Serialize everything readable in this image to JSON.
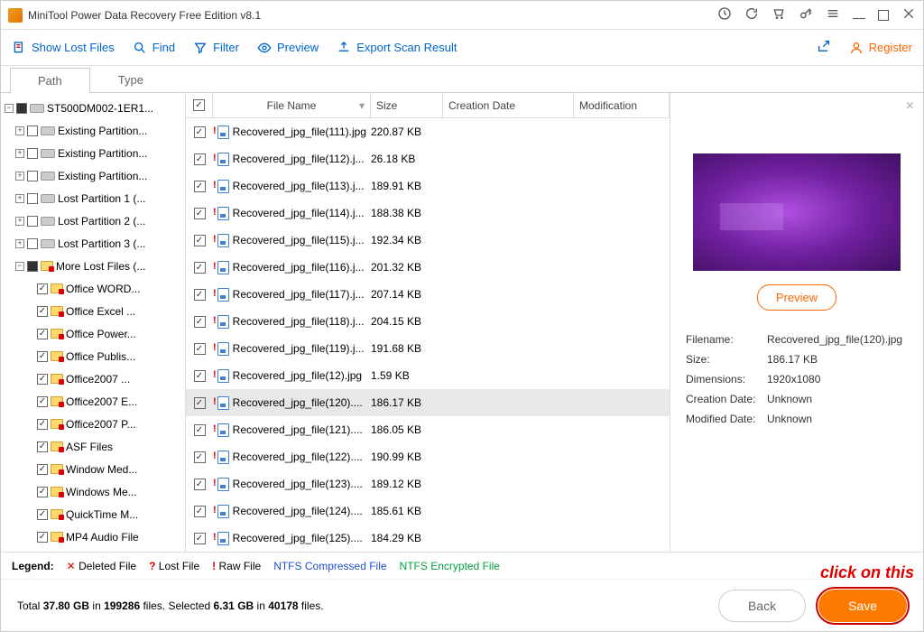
{
  "window": {
    "title": "MiniTool Power Data Recovery Free Edition v8.1"
  },
  "toolbar": {
    "showLost": "Show Lost Files",
    "find": "Find",
    "filter": "Filter",
    "preview": "Preview",
    "export": "Export Scan Result",
    "register": "Register"
  },
  "tabs": {
    "path": "Path",
    "type": "Type"
  },
  "tree": {
    "root": "ST500DM002-1ER1...",
    "items": [
      "Existing Partition...",
      "Existing Partition...",
      "Existing Partition...",
      "Lost Partition 1 (...",
      "Lost Partition 2 (...",
      "Lost Partition 3 (..."
    ],
    "moreLost": "More Lost Files (...",
    "sub": [
      "Office WORD...",
      "Office Excel ...",
      "Office Power...",
      "Office Publis...",
      "Office2007 ...",
      "Office2007 E...",
      "Office2007 P...",
      "ASF Files",
      "Window Med...",
      "Windows Me...",
      "QuickTime M...",
      "MP4 Audio File"
    ]
  },
  "columns": {
    "name": "File Name",
    "size": "Size",
    "cdate": "Creation Date",
    "mdate": "Modification"
  },
  "files": [
    {
      "name": "Recovered_jpg_file(111).jpg",
      "size": "220.87 KB"
    },
    {
      "name": "Recovered_jpg_file(112).j...",
      "size": "26.18 KB"
    },
    {
      "name": "Recovered_jpg_file(113).j...",
      "size": "189.91 KB"
    },
    {
      "name": "Recovered_jpg_file(114).j...",
      "size": "188.38 KB"
    },
    {
      "name": "Recovered_jpg_file(115).j...",
      "size": "192.34 KB"
    },
    {
      "name": "Recovered_jpg_file(116).j...",
      "size": "201.32 KB"
    },
    {
      "name": "Recovered_jpg_file(117).j...",
      "size": "207.14 KB"
    },
    {
      "name": "Recovered_jpg_file(118).j...",
      "size": "204.15 KB"
    },
    {
      "name": "Recovered_jpg_file(119).j...",
      "size": "191.68 KB"
    },
    {
      "name": "Recovered_jpg_file(12).jpg",
      "size": "1.59 KB"
    },
    {
      "name": "Recovered_jpg_file(120)....",
      "size": "186.17 KB",
      "sel": true
    },
    {
      "name": "Recovered_jpg_file(121)....",
      "size": "186.05 KB"
    },
    {
      "name": "Recovered_jpg_file(122)....",
      "size": "190.99 KB"
    },
    {
      "name": "Recovered_jpg_file(123)....",
      "size": "189.12 KB"
    },
    {
      "name": "Recovered_jpg_file(124)....",
      "size": "185.61 KB"
    },
    {
      "name": "Recovered_jpg_file(125)....",
      "size": "184.29 KB"
    }
  ],
  "preview": {
    "button": "Preview",
    "filenameLabel": "Filename:",
    "filename": "Recovered_jpg_file(120).jpg",
    "sizeLabel": "Size:",
    "size": "186.17 KB",
    "dimLabel": "Dimensions:",
    "dim": "1920x1080",
    "cdateLabel": "Creation Date:",
    "cdate": "Unknown",
    "mdateLabel": "Modified Date:",
    "mdate": "Unknown"
  },
  "legend": {
    "label": "Legend:",
    "deleted": "Deleted File",
    "lost": "Lost File",
    "raw": "Raw File",
    "ntfsc": "NTFS Compressed File",
    "ntfse": "NTFS Encrypted File"
  },
  "footer": {
    "total_pre": "Total ",
    "total_size": "37.80 GB",
    "in1": " in ",
    "total_files": "199286",
    "files_sel": " files.  Selected ",
    "sel_size": "6.31 GB",
    "in2": " in ",
    "sel_files": "40178",
    "suffix": " files.",
    "back": "Back",
    "save": "Save"
  },
  "annotation": "click on this"
}
